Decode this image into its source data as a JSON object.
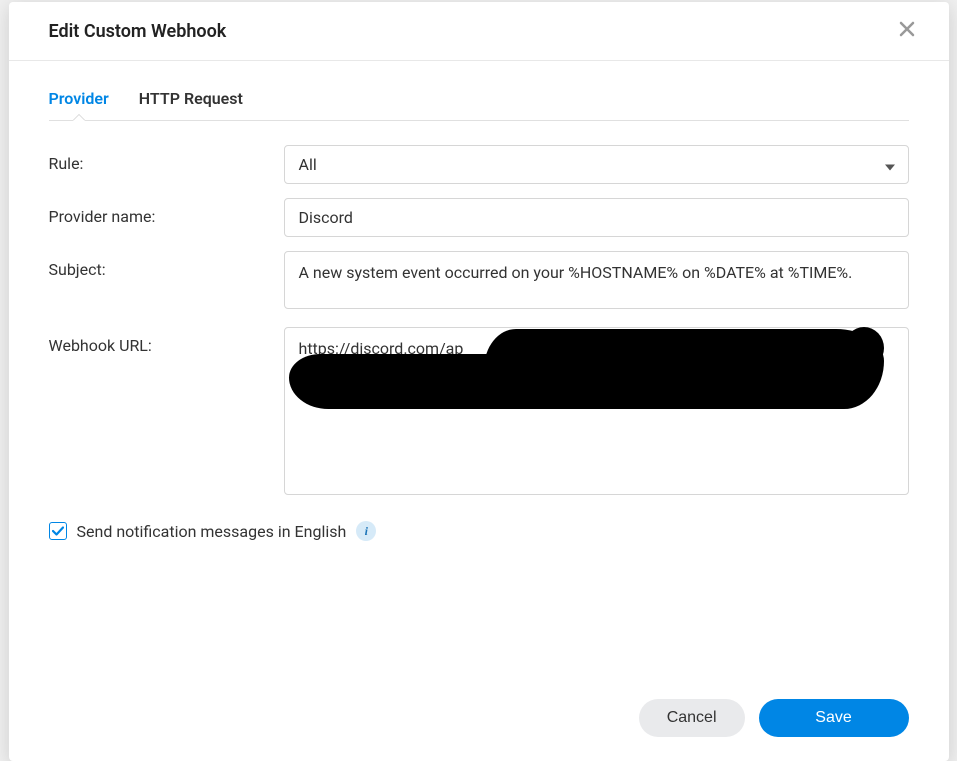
{
  "dialog": {
    "title": "Edit Custom Webhook"
  },
  "tabs": {
    "provider": "Provider",
    "http_request": "HTTP Request"
  },
  "form": {
    "rule_label": "Rule:",
    "rule_value": "All",
    "provider_name_label": "Provider name:",
    "provider_name_value": "Discord",
    "subject_label": "Subject:",
    "subject_value": "A new system event occurred on your %HOSTNAME% on %DATE% at %TIME%.",
    "webhook_url_label": "Webhook URL:",
    "webhook_url_value": "https://discord.com/ap",
    "english_checkbox_label": "Send notification messages in English",
    "english_checkbox_checked": true
  },
  "footer": {
    "cancel": "Cancel",
    "save": "Save"
  }
}
